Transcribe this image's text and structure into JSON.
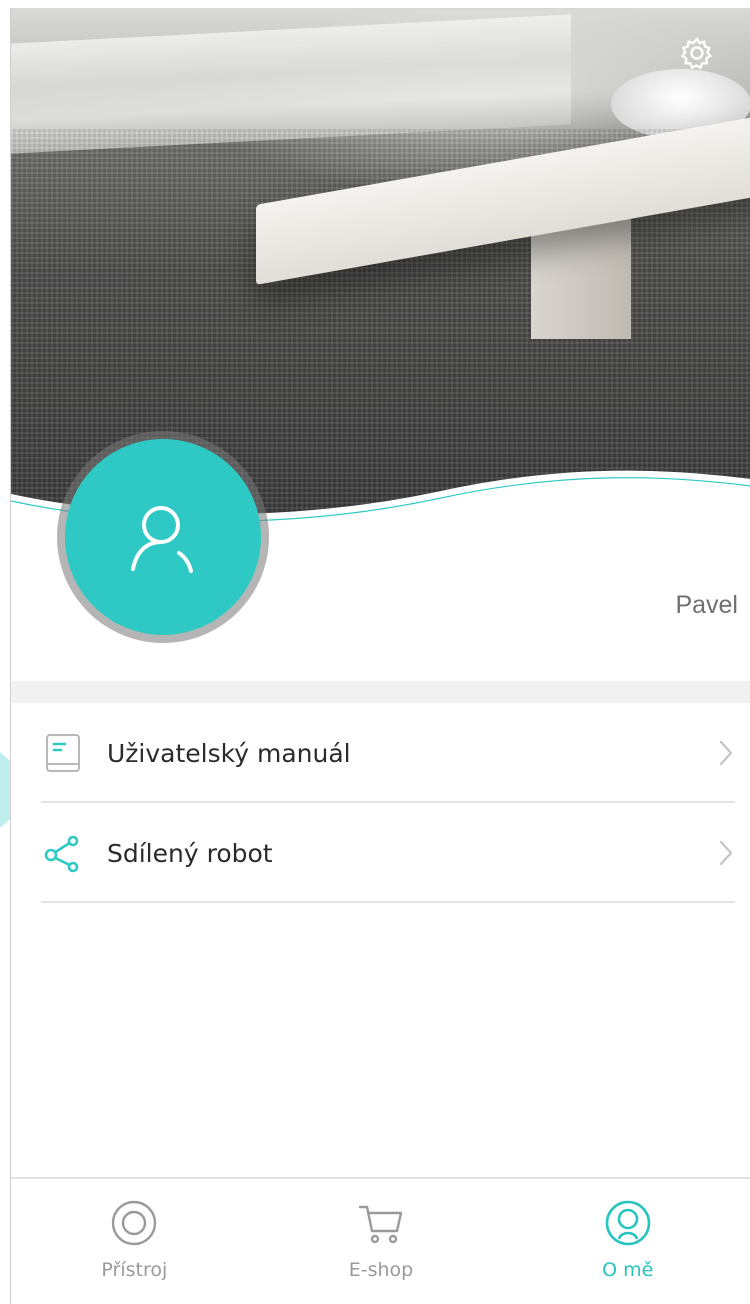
{
  "profile": {
    "username": "Pavel"
  },
  "menu": {
    "items": [
      {
        "label": "Uživatelský manuál",
        "icon": "manual-icon"
      },
      {
        "label": "Sdílený robot",
        "icon": "share-icon"
      }
    ]
  },
  "tabbar": {
    "tabs": [
      {
        "label": "Přístroj",
        "icon": "device-icon",
        "active": false
      },
      {
        "label": "E-shop",
        "icon": "cart-icon",
        "active": false
      },
      {
        "label": "O mě",
        "icon": "profile-icon",
        "active": true
      }
    ]
  },
  "colors": {
    "accent": "#2ec9c4",
    "tab_active": "#25c4be",
    "tab_inactive": "#9a9a9a",
    "text": "#2b2b2b"
  }
}
